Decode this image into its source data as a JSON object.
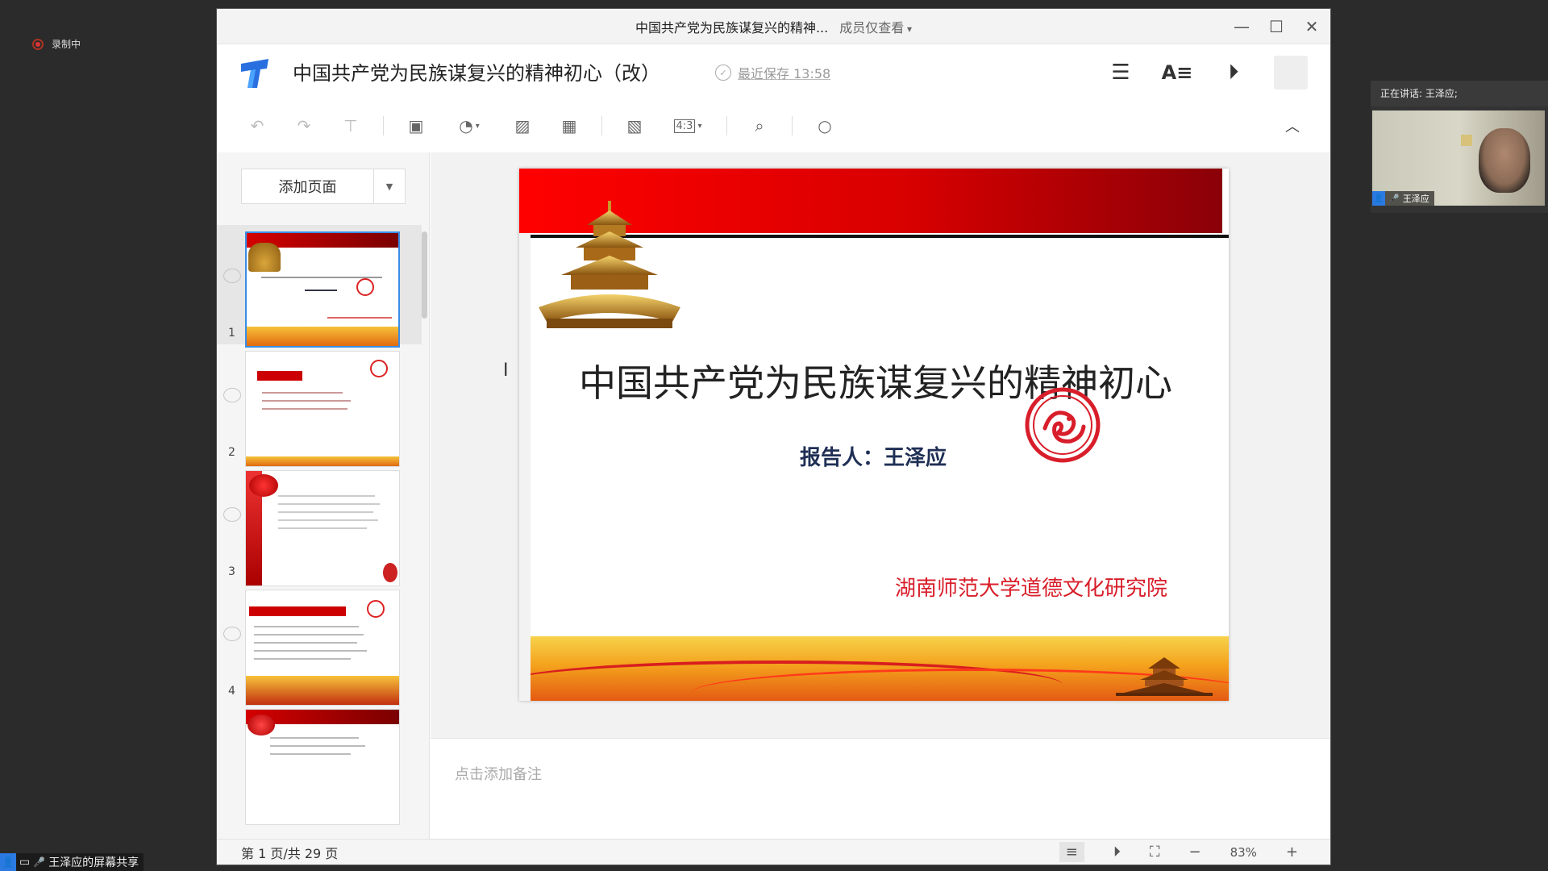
{
  "recording": {
    "label": "录制中"
  },
  "share_label": "王泽应的屏幕共享",
  "speaker": {
    "title": "正在讲话: 王泽应;",
    "name": "王泽应"
  },
  "window": {
    "title": "中国共产党为民族谋复兴的精神...",
    "readonly": "成员仅查看"
  },
  "header": {
    "doc_title": "中国共产党为民族谋复兴的精神初心（改）",
    "saved": "最近保存 13:58"
  },
  "toolbar": {
    "ratio": "4:3"
  },
  "thumbs": {
    "add_page": "添加页面",
    "items": [
      {
        "num": "1"
      },
      {
        "num": "2"
      },
      {
        "num": "3"
      },
      {
        "num": "4"
      }
    ]
  },
  "slide": {
    "title": "中国共产党为民族谋复兴的精神初心",
    "reporter": "报告人：王泽应",
    "institution": "湖南师范大学道德文化研究院"
  },
  "notes": {
    "placeholder": "点击添加备注"
  },
  "status": {
    "page": "第 1 页/共 29 页",
    "zoom": "83%"
  },
  "colors": {
    "accent": "#3a8de6",
    "slide_red": "#d80000",
    "inst_red": "#d81e2a"
  }
}
